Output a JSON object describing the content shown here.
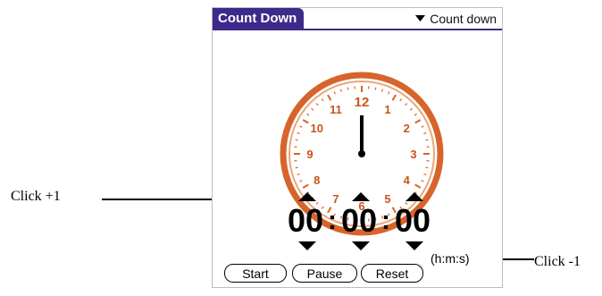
{
  "app": {
    "title": "Count Down",
    "mode_picker": {
      "selected": "Count down",
      "icon": "triangle-down-icon"
    }
  },
  "clock": {
    "numbers": [
      "12",
      "1",
      "2",
      "3",
      "4",
      "5",
      "6",
      "7",
      "8",
      "9",
      "10",
      "11"
    ],
    "ring_color": "#d7642a",
    "face_color": "#ffffff"
  },
  "timer": {
    "units_label": "(h:m:s)",
    "hours": "00",
    "minutes": "00",
    "seconds": "00",
    "separator": ":"
  },
  "buttons": {
    "start": "Start",
    "pause": "Pause",
    "reset": "Reset"
  },
  "annotations": {
    "increment": "Click +1",
    "decrement": "Click -1"
  }
}
